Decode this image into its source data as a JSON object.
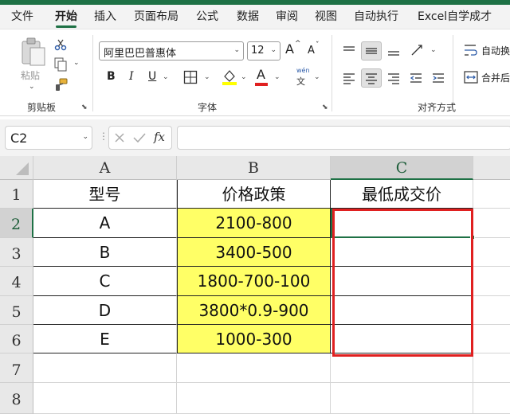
{
  "menu": {
    "tabs": [
      {
        "label": "文件"
      },
      {
        "label": "开始"
      },
      {
        "label": "插入"
      },
      {
        "label": "页面布局"
      },
      {
        "label": "公式"
      },
      {
        "label": "数据"
      },
      {
        "label": "审阅"
      },
      {
        "label": "视图"
      },
      {
        "label": "自动执行"
      },
      {
        "label": "Excel自学成才"
      }
    ],
    "active_tab": "开始"
  },
  "ribbon": {
    "clipboard": {
      "paste_label": "粘贴",
      "group_label": "剪贴板"
    },
    "font": {
      "font_name": "阿里巴巴普惠体",
      "font_size": "12",
      "bold_label": "B",
      "italic_label": "I",
      "underline_label": "U",
      "font_color_glyph": "A",
      "phonetic_label": "wén",
      "phonetic_glyph": "文",
      "increase_glyph": "A",
      "decrease_glyph": "A",
      "group_label": "字体"
    },
    "alignment": {
      "wrap_label": "自动换",
      "merge_label": "合并后",
      "group_label": "对齐方式"
    }
  },
  "formula_bar": {
    "name_box": "C2",
    "fx_label": "fx",
    "formula": ""
  },
  "sheet": {
    "columns": [
      "A",
      "B",
      "C"
    ],
    "rows": [
      "1",
      "2",
      "3",
      "4",
      "5",
      "6",
      "7",
      "8"
    ],
    "selected_cell": "C2",
    "header": [
      "型号",
      "价格政策",
      "最低成交价"
    ],
    "data": [
      [
        "A",
        "2100-800",
        ""
      ],
      [
        "B",
        "3400-500",
        ""
      ],
      [
        "C",
        "1800-700-100",
        ""
      ],
      [
        "D",
        "3800*0.9-900",
        ""
      ],
      [
        "E",
        "1000-300",
        ""
      ]
    ]
  },
  "colors": {
    "accent": "#1e7145",
    "highlight_yellow": "#ffff66",
    "annotation_red": "#e02020"
  }
}
